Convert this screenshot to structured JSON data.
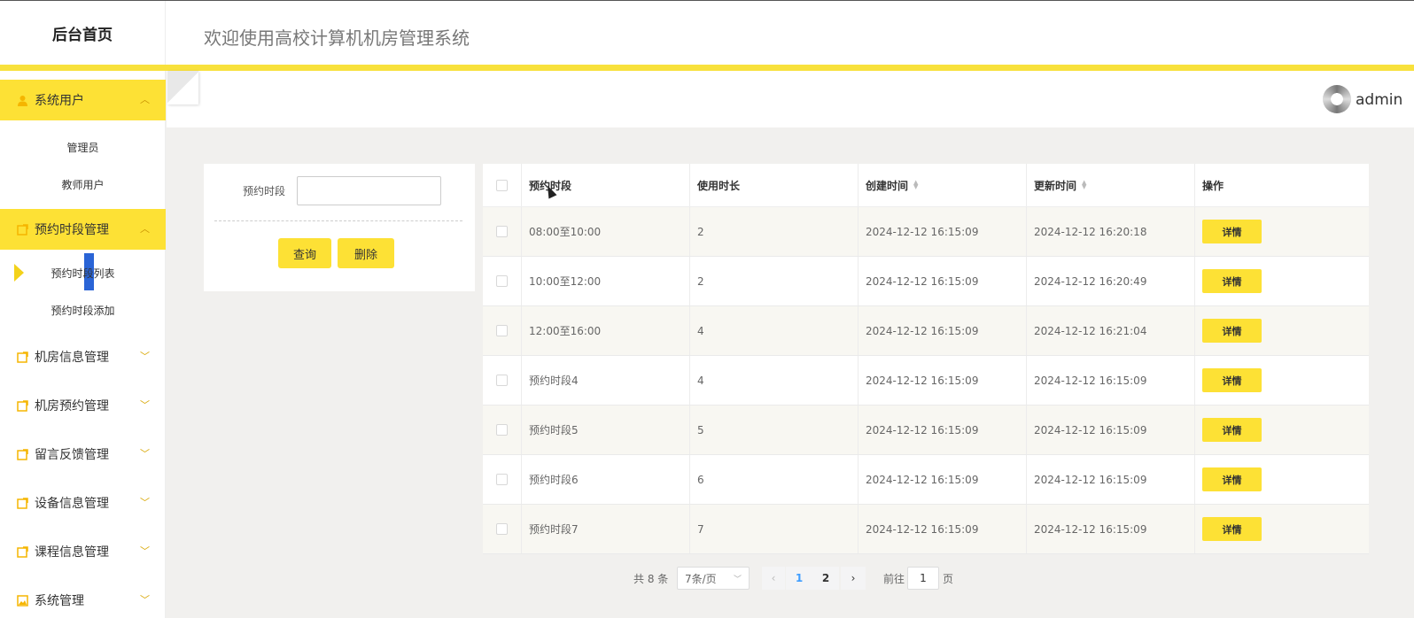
{
  "header": {
    "brand": "后台首页",
    "welcome": "欢迎使用高校计算机机房管理系统"
  },
  "user": {
    "name": "admin"
  },
  "sidebar": {
    "groups": [
      {
        "label": "系统用户",
        "icon": "user-icon",
        "items": [
          "管理员",
          "教师用户"
        ]
      },
      {
        "label": "预约时段管理",
        "icon": "edit-icon",
        "items": [
          "预约时段列表",
          "预约时段添加"
        ]
      },
      {
        "label": "机房信息管理",
        "icon": "edit-icon"
      },
      {
        "label": "机房预约管理",
        "icon": "edit-icon"
      },
      {
        "label": "留言反馈管理",
        "icon": "edit-icon"
      },
      {
        "label": "设备信息管理",
        "icon": "edit-icon"
      },
      {
        "label": "课程信息管理",
        "icon": "edit-icon"
      },
      {
        "label": "系统管理",
        "icon": "image-icon"
      }
    ]
  },
  "search": {
    "label": "预约时段",
    "value": "",
    "query_button": "查询",
    "delete_button": "删除"
  },
  "table": {
    "columns": [
      "预约时段",
      "使用时长",
      "创建时间",
      "更新时间",
      "操作"
    ],
    "detail_label": "详情",
    "rows": [
      {
        "period": "08:00至10:00",
        "duration": "2",
        "created": "2024-12-12 16:15:09",
        "updated": "2024-12-12 16:20:18"
      },
      {
        "period": "10:00至12:00",
        "duration": "2",
        "created": "2024-12-12 16:15:09",
        "updated": "2024-12-12 16:20:49"
      },
      {
        "period": "12:00至16:00",
        "duration": "4",
        "created": "2024-12-12 16:15:09",
        "updated": "2024-12-12 16:21:04"
      },
      {
        "period": "预约时段4",
        "duration": "4",
        "created": "2024-12-12 16:15:09",
        "updated": "2024-12-12 16:15:09"
      },
      {
        "period": "预约时段5",
        "duration": "5",
        "created": "2024-12-12 16:15:09",
        "updated": "2024-12-12 16:15:09"
      },
      {
        "period": "预约时段6",
        "duration": "6",
        "created": "2024-12-12 16:15:09",
        "updated": "2024-12-12 16:15:09"
      },
      {
        "period": "预约时段7",
        "duration": "7",
        "created": "2024-12-12 16:15:09",
        "updated": "2024-12-12 16:15:09"
      }
    ]
  },
  "pagination": {
    "total": "共 8 条",
    "page_size": "7条/页",
    "pages": [
      "1",
      "2"
    ],
    "current_page": "1",
    "goto_label": "前往",
    "goto_value": "1",
    "page_suffix": "页"
  },
  "colors": {
    "accent": "#fde135",
    "header_line": "#f8e13c",
    "active_page": "#409eff"
  }
}
